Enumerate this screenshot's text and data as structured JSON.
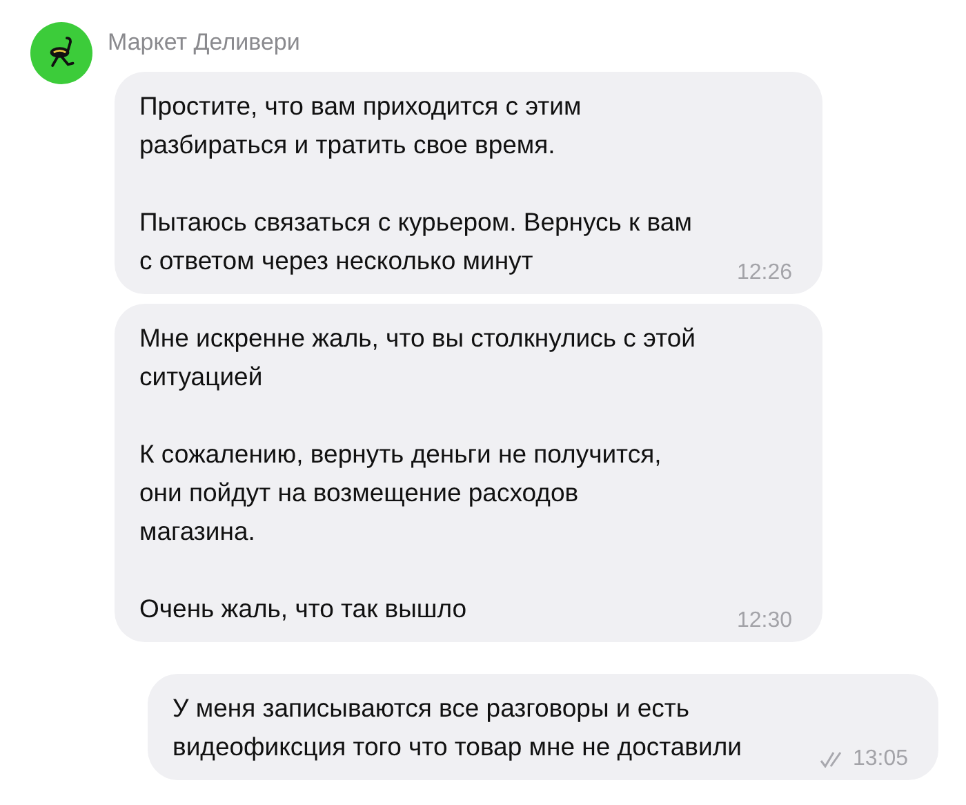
{
  "chat": {
    "title": "Маркет Деливери"
  },
  "messages": [
    {
      "kind": "incoming",
      "paragraphs": [
        "Простите, что вам приходится с этим\nразбираться и тратить свое время.",
        "Пытаюсь связаться с курьером. Вернусь к вам\nс ответом через несколько минут"
      ],
      "time": "12:26",
      "read": false
    },
    {
      "kind": "incoming",
      "paragraphs": [
        "Мне искренне жаль, что вы столкнулись с этой\nситуацией",
        "К сожалению, вернуть деньги не получится,\nони пойдут на возмещение расходов\nмагазина.",
        "Очень жаль, что так вышло"
      ],
      "time": "12:30",
      "read": false
    },
    {
      "kind": "outgoing",
      "paragraphs": [
        "У меня записываются все разговоры и есть\nвидеофиксция того что товар мне не доставили"
      ],
      "time": "13:05",
      "read": true
    }
  ]
}
